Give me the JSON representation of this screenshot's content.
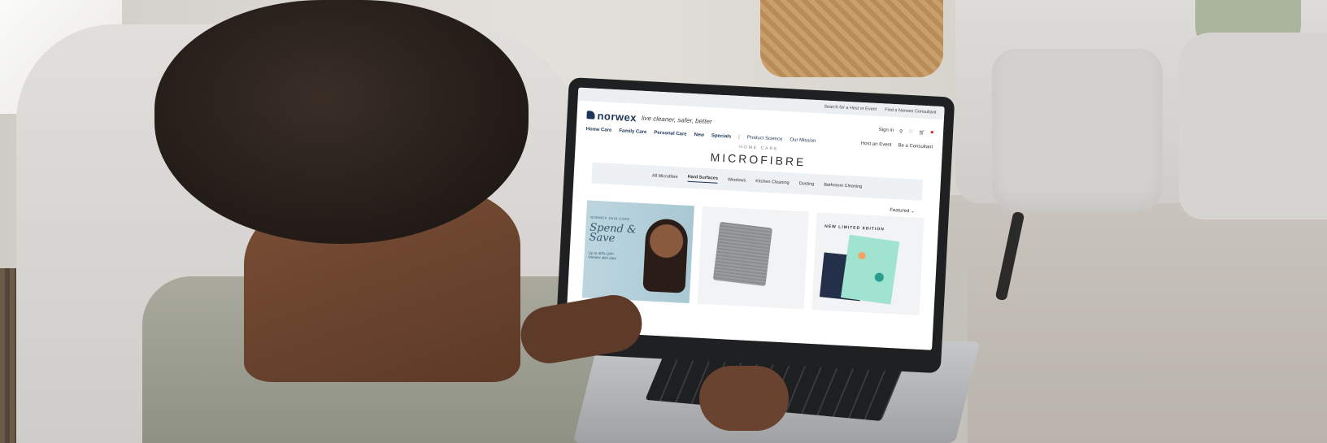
{
  "site": {
    "logo_text": "norwex",
    "tagline": "live cleaner, safer, better",
    "utility_links": [
      "Search for a Host or Event",
      "Find a Norwex Consultant"
    ],
    "header_actions": {
      "sign_in": "Sign in"
    },
    "nav_items": [
      "Home Care",
      "Family Care",
      "Personal Care",
      "New",
      "Specials"
    ],
    "nav_secondary": [
      "Product Science",
      "Our Mission"
    ],
    "nav_right": [
      "Host an Event",
      "Be a Consultant"
    ],
    "eyebrow": "HOME CARE",
    "page_title": "MICROFIBRE",
    "subnav": [
      "All Microfibre",
      "Hard Surfaces",
      "Windows",
      "Kitchen Cleaning",
      "Dusting",
      "Bathroom Cleaning"
    ],
    "subnav_active": "Hard Surfaces",
    "sort_label": "Featured",
    "promo": {
      "brand": "NORWEX SKIN CARE",
      "headline": "Spend & Save",
      "subtext": "Up to 40% OFF Norwex skin care"
    },
    "card3_label": "NEW LIMITED EDITION"
  },
  "icons": [
    "search-icon",
    "heart-icon",
    "cart-icon",
    "flag-icon",
    "chevron-down-icon"
  ],
  "colors": {
    "brand": "#1d3557",
    "promo_bg": "#bcd6df"
  }
}
